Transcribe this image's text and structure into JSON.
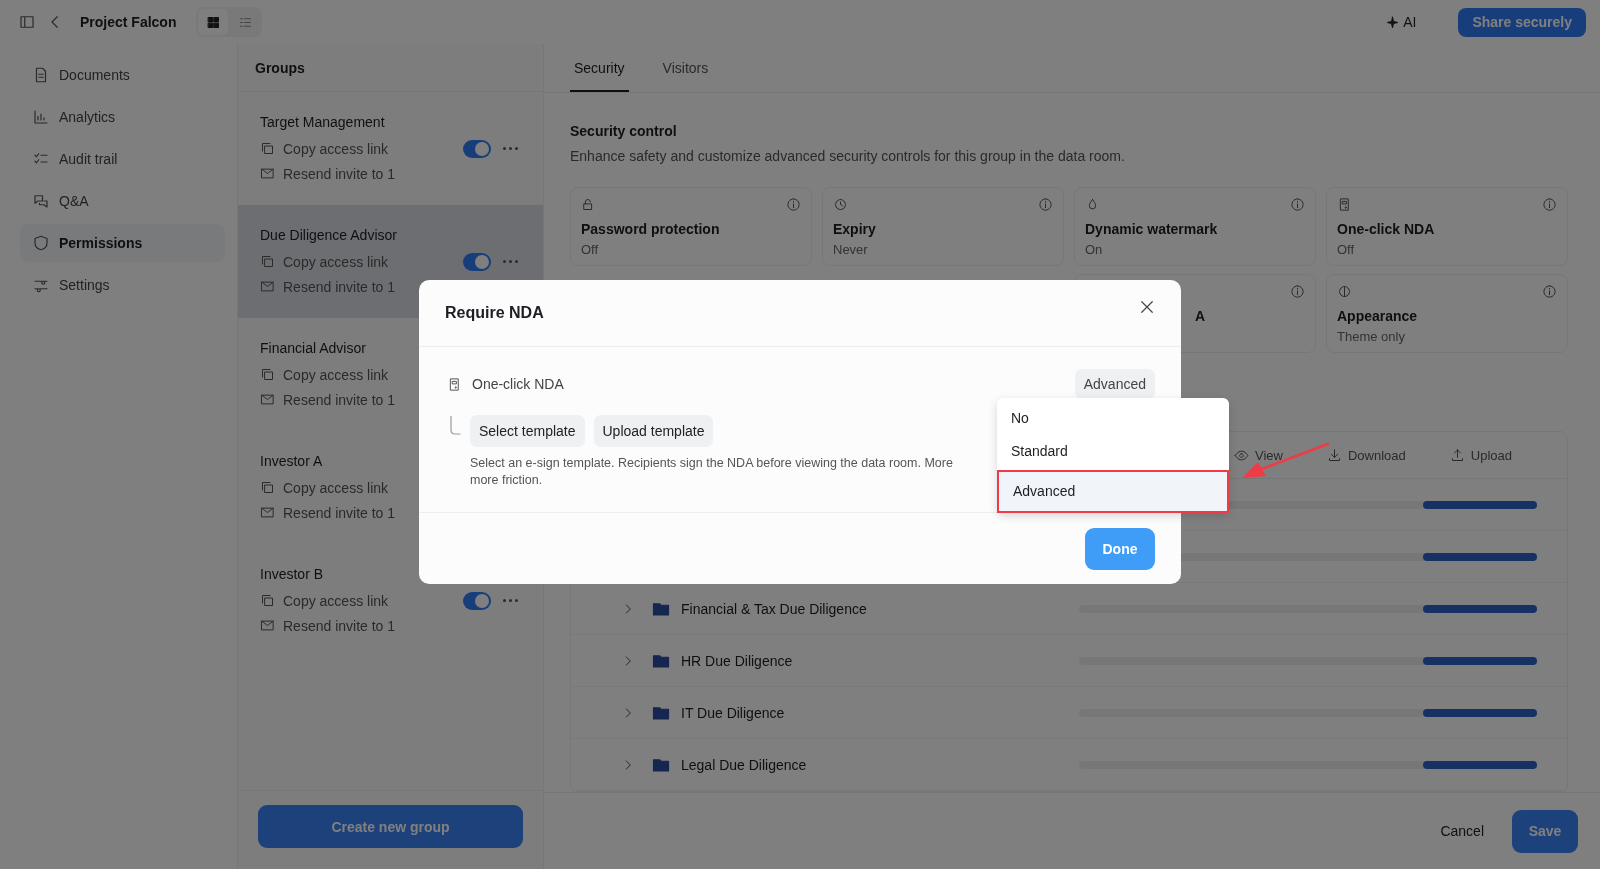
{
  "topbar": {
    "title": "Project Falcon",
    "views": [
      {
        "selected": true
      },
      {
        "selected": false
      }
    ],
    "ai": "AI",
    "share": "Share securely"
  },
  "sidebar": {
    "items": [
      {
        "label": "Documents",
        "selected": false
      },
      {
        "label": "Analytics",
        "selected": false
      },
      {
        "label": "Audit trail",
        "selected": false
      },
      {
        "label": "Q&A",
        "selected": false
      },
      {
        "label": "Permissions",
        "selected": true
      },
      {
        "label": "Settings",
        "selected": false
      }
    ]
  },
  "groups": {
    "title": "Groups",
    "items": [
      {
        "name": "Target Management",
        "copy": "Copy access link",
        "resend": "Resend invite to 1",
        "selected": false,
        "on": true
      },
      {
        "name": "Due Diligence Advisor",
        "copy": "Copy access link",
        "resend": "Resend invite to 1",
        "selected": true,
        "on": true
      },
      {
        "name": "Financial Advisor",
        "copy": "Copy access link",
        "resend": "Resend invite to 1",
        "selected": false
      },
      {
        "name": "Investor A",
        "copy": "Copy access link",
        "resend": "Resend invite to 1",
        "selected": false
      },
      {
        "name": "Investor B",
        "copy": "Copy access link",
        "resend": "Resend invite to 1",
        "selected": false,
        "on": true
      }
    ],
    "create": "Create new group"
  },
  "tabs": [
    {
      "label": "Security",
      "selected": true
    },
    {
      "label": "Visitors",
      "selected": false
    }
  ],
  "security": {
    "title": "Security control",
    "description": "Enhance safety and customize advanced security controls for this group in the data room.",
    "cards": [
      {
        "title": "Password protection",
        "value": "Off"
      },
      {
        "title": "Expiry",
        "value": "Never"
      },
      {
        "title": "Dynamic watermark",
        "value": "On"
      },
      {
        "title": "One-click NDA",
        "value": "Off"
      },
      {
        "title": "A"
      },
      {
        "title": "Appearance",
        "value": "Theme only"
      }
    ]
  },
  "table": {
    "columns": [
      "View",
      "Download",
      "Upload"
    ],
    "rows": [
      {
        "level": 0.25
      },
      {
        "level": 0.25
      },
      {
        "name": "Financial & Tax Due Diligence",
        "level": 0.25
      },
      {
        "name": "HR Due Diligence",
        "level": 0.25
      },
      {
        "name": "IT Due Diligence",
        "level": 0.25
      },
      {
        "name": "Legal Due Diligence",
        "level": 0.25
      }
    ]
  },
  "footer": {
    "cancel": "Cancel",
    "save": "Save"
  },
  "modal": {
    "title": "Require NDA",
    "option": "One-click NDA",
    "value": "Advanced",
    "buttons": [
      "Select template",
      "Upload template"
    ],
    "description": [
      "Select an e-sign template. Recipients sign the NDA before viewing the data room. More",
      "more friction."
    ],
    "done": "Done"
  },
  "dropdown": {
    "options": [
      {
        "label": "No",
        "selected": false
      },
      {
        "label": "Standard",
        "selected": false
      },
      {
        "label": "Advanced",
        "selected": true
      }
    ]
  }
}
